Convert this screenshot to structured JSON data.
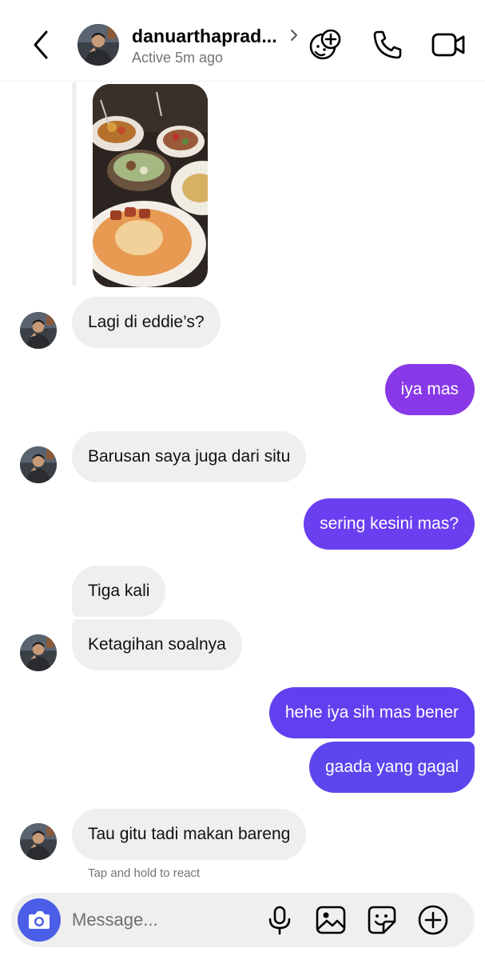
{
  "header": {
    "username": "danuarthaprad...",
    "status": "Active 5m ago"
  },
  "colors": {
    "outgoing_gradient_top": "#8a3ae6",
    "outgoing_gradient_bottom": "#5a48ec",
    "incoming_bubble": "#efeff0",
    "camera_button": "#4a5ee8"
  },
  "messages": [
    {
      "from": "them",
      "text": "Lagi di eddie’s?"
    },
    {
      "from": "me",
      "text": "iya mas"
    },
    {
      "from": "them",
      "text": "Barusan saya juga dari situ"
    },
    {
      "from": "me",
      "text": "sering kesini mas?"
    },
    {
      "from": "them",
      "text": "Tiga kali"
    },
    {
      "from": "them",
      "text": "Ketagihan soalnya"
    },
    {
      "from": "me",
      "text": "hehe iya sih mas bener"
    },
    {
      "from": "me",
      "text": "gaada yang gagal"
    },
    {
      "from": "them",
      "text": "Tau gitu tadi makan bareng"
    }
  ],
  "react_hint": "Tap and hold to react",
  "composer": {
    "placeholder": "Message..."
  },
  "icons": {
    "back": "chevron-left-icon",
    "effects": "smiley-plus-icon",
    "call": "phone-icon",
    "video": "video-camera-icon",
    "camera": "camera-icon",
    "mic": "microphone-icon",
    "gallery": "image-icon",
    "sticker": "sticker-icon",
    "plus": "plus-circle-icon"
  }
}
